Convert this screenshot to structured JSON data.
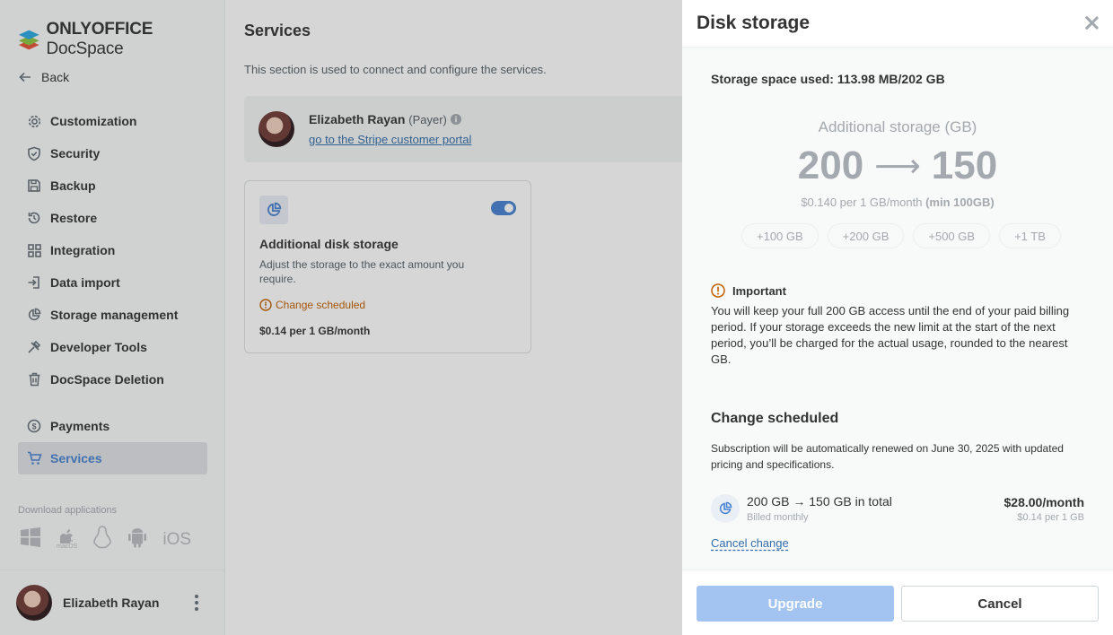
{
  "app": {
    "logo_brand": "ONLYOFFICE",
    "logo_product": "DocSpace"
  },
  "sidebar": {
    "back_label": "Back",
    "items": [
      {
        "label": "Customization",
        "icon": "gear-icon"
      },
      {
        "label": "Security",
        "icon": "shield-icon"
      },
      {
        "label": "Backup",
        "icon": "save-icon"
      },
      {
        "label": "Restore",
        "icon": "restore-icon"
      },
      {
        "label": "Integration",
        "icon": "grid-icon"
      },
      {
        "label": "Data import",
        "icon": "import-icon"
      },
      {
        "label": "Storage management",
        "icon": "pie-chart-icon"
      },
      {
        "label": "Developer Tools",
        "icon": "tools-icon"
      },
      {
        "label": "DocSpace Deletion",
        "icon": "trash-icon"
      }
    ],
    "items2": [
      {
        "label": "Payments",
        "icon": "dollar-icon"
      },
      {
        "label": "Services",
        "icon": "cart-icon",
        "active": true
      }
    ],
    "download_title": "Download applications",
    "download_platforms": [
      "windows-icon",
      "macos-icon",
      "linux-icon",
      "android-icon",
      "ios-icon"
    ],
    "macos_label": "macOS",
    "ios_label": "iOS",
    "user_name": "Elizabeth Rayan"
  },
  "main": {
    "title": "Services",
    "description": "This section is used to connect and configure the services.",
    "payer": {
      "name": "Elizabeth Rayan",
      "role": "(Payer)",
      "link": "go to the Stripe customer portal"
    },
    "service_card": {
      "title": "Additional disk storage",
      "description": "Adjust the storage to the exact amount you require.",
      "status": "Change scheduled",
      "price": "$0.14 per 1 GB/month",
      "toggle_on": true
    }
  },
  "panel": {
    "title": "Disk storage",
    "used_label": "Storage space used: 113.98 MB/202 GB",
    "additional_label": "Additional storage (GB)",
    "from_value": "200",
    "arrow": "⟶",
    "to_value": "150",
    "rate": "$0.140 per 1 GB/month",
    "rate_min": "(min 100GB)",
    "chips": [
      "+100 GB",
      "+200 GB",
      "+500 GB",
      "+1 TB"
    ],
    "important_title": "Important",
    "important_text": "You will keep your full 200 GB access until the end of your paid billing period. If your storage exceeds the new limit at the start of the next period, you’ll be charged for the actual usage, rounded to the nearest GB.",
    "change_title": "Change scheduled",
    "change_desc": "Subscription will be automatically renewed on June 30, 2025 with updated pricing and specifications.",
    "change_main": "200 GB → 150 GB in total",
    "change_sub": "Billed monthly",
    "change_price": "$28.00/month",
    "change_price_sub": "$0.14 per 1 GB",
    "cancel_change": "Cancel change",
    "upgrade_button": "Upgrade",
    "cancel_button": "Cancel"
  },
  "colors": {
    "accent": "#4781d1",
    "link": "#316daa",
    "warning": "#c35f00",
    "upgrade_disabled": "#a3c4f1"
  }
}
